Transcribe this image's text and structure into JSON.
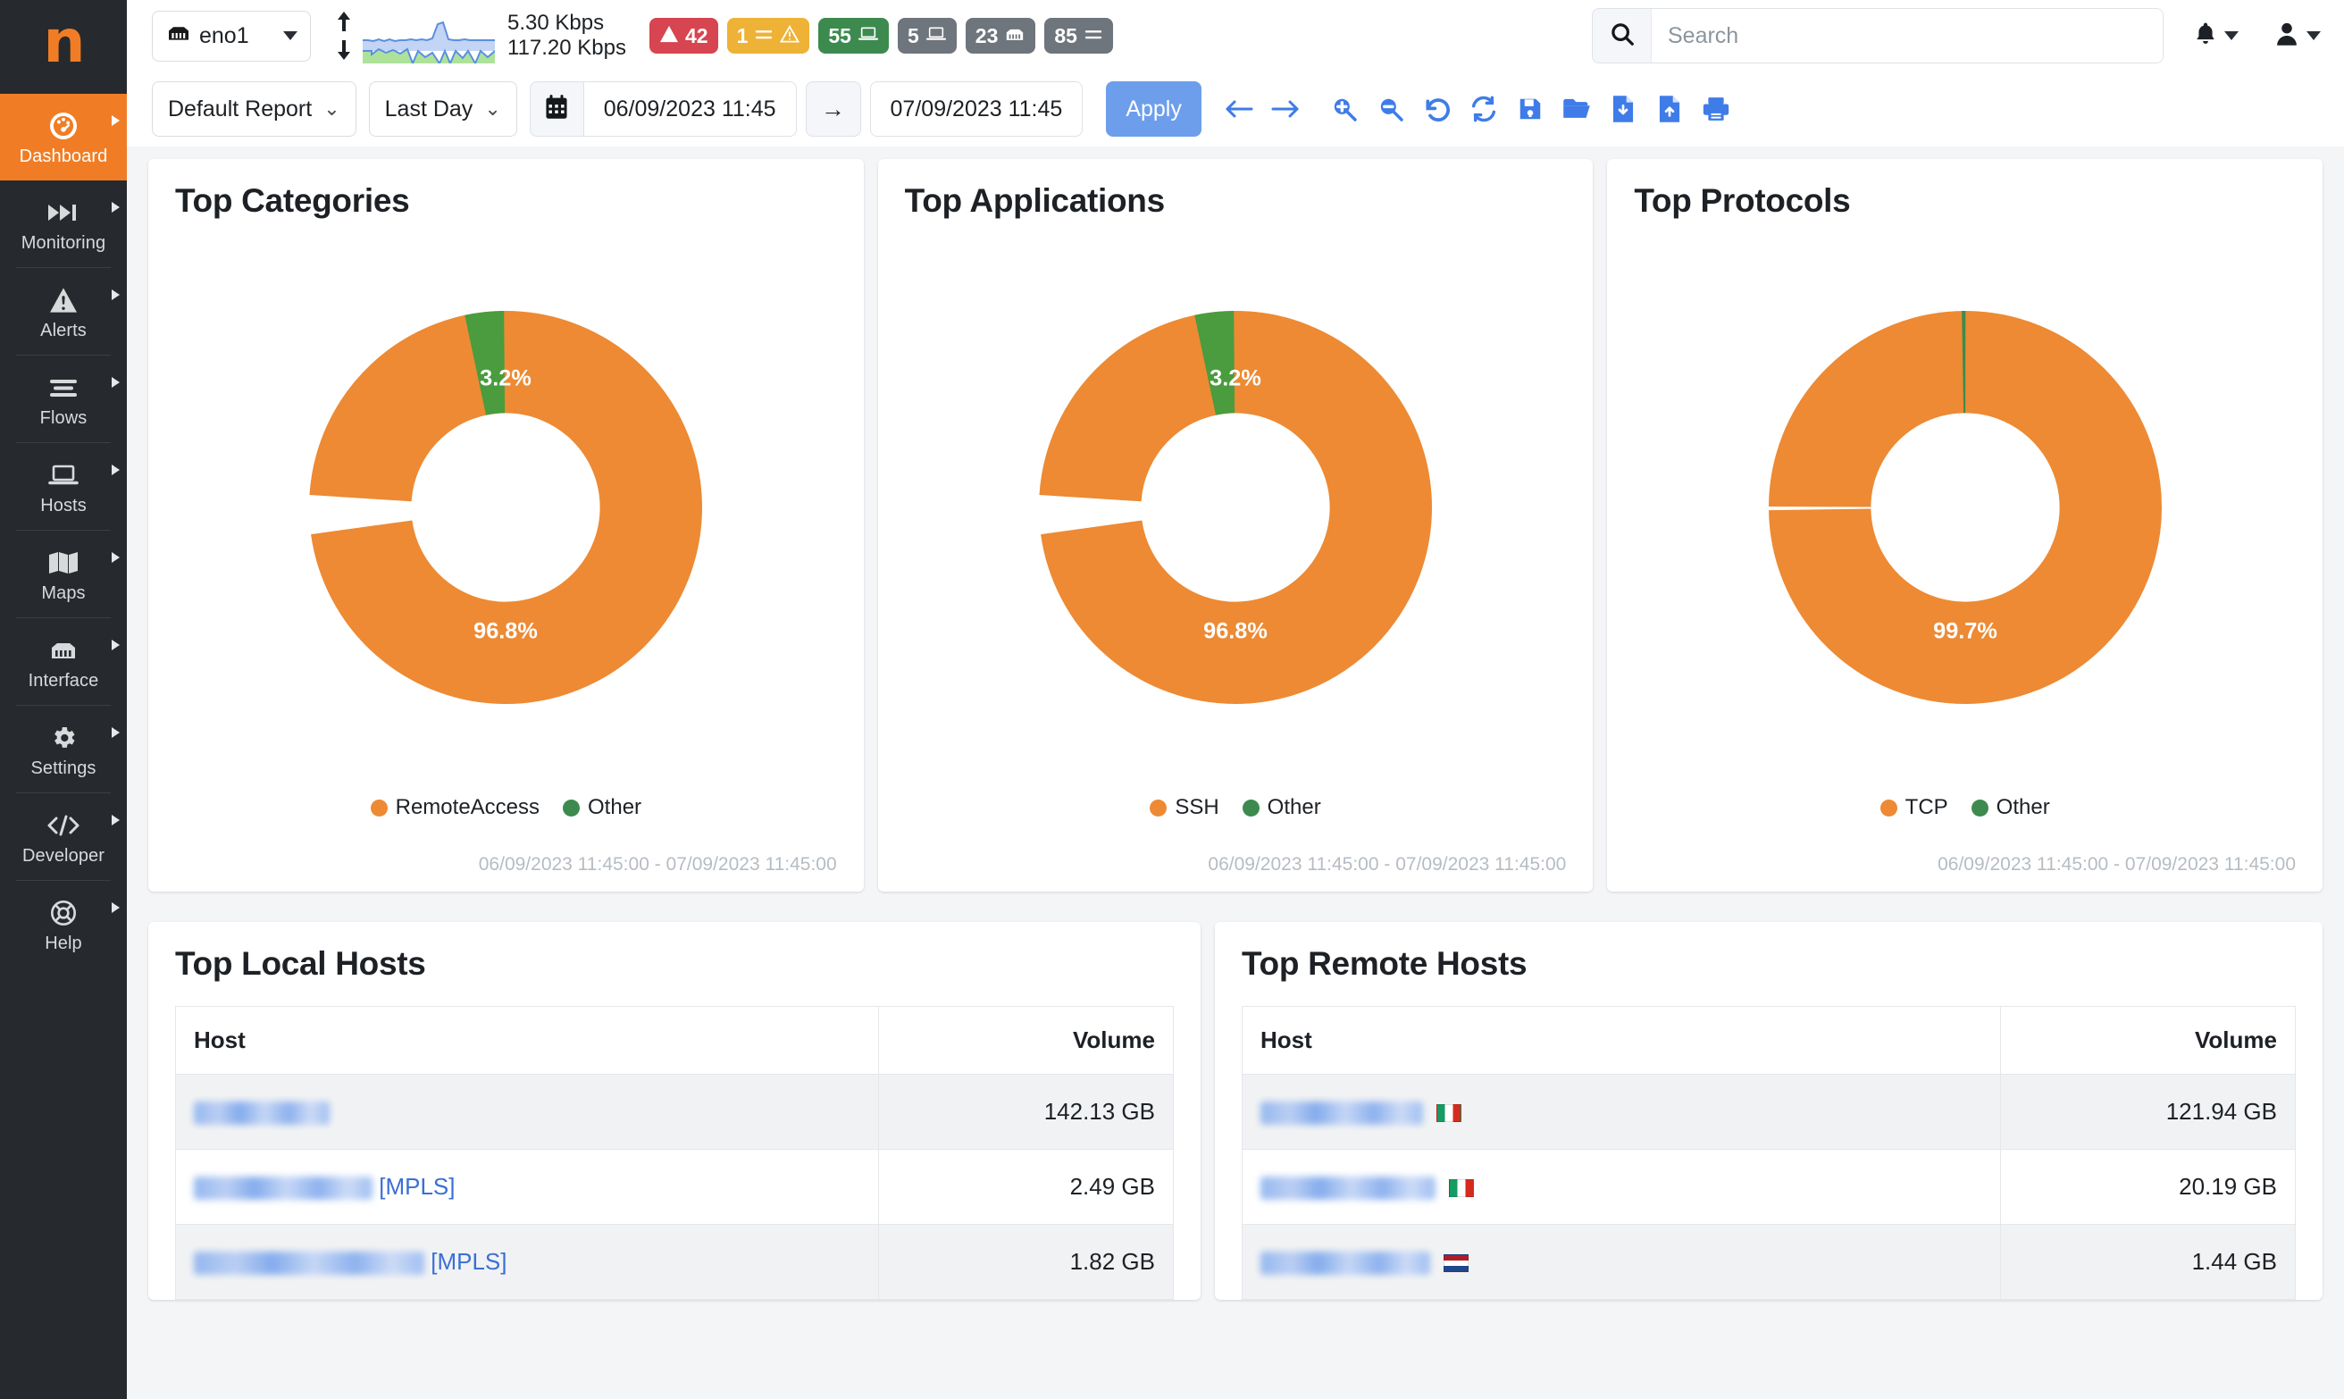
{
  "sidebar": {
    "logo": "n",
    "items": [
      {
        "label": "Dashboard",
        "icon": "dashboard-gauge-icon",
        "active": true
      },
      {
        "label": "Monitoring",
        "icon": "fast-forward-icon",
        "active": false
      },
      {
        "label": "Alerts",
        "icon": "warning-triangle-icon",
        "active": false
      },
      {
        "label": "Flows",
        "icon": "list-lines-icon",
        "active": false
      },
      {
        "label": "Hosts",
        "icon": "laptop-icon",
        "active": false
      },
      {
        "label": "Maps",
        "icon": "map-icon",
        "active": false
      },
      {
        "label": "Interface",
        "icon": "ethernet-port-icon",
        "active": false
      },
      {
        "label": "Settings",
        "icon": "gear-icon",
        "active": false
      },
      {
        "label": "Developer",
        "icon": "code-brackets-icon",
        "active": false
      },
      {
        "label": "Help",
        "icon": "lifebuoy-icon",
        "active": false
      }
    ]
  },
  "header": {
    "interface_selected": "eno1",
    "interface_icon": "ethernet-port-icon",
    "rate_up": "5.30 Kbps",
    "rate_down": "117.20 Kbps",
    "badges": [
      {
        "value": "42",
        "icon": "alert-triangle-icon",
        "color": "#d64550",
        "name": "alerts-badge"
      },
      {
        "value": "1",
        "icon": "flows-alert-icon",
        "color": "#eeb237",
        "name": "flow-alerts-badge"
      },
      {
        "value": "55",
        "icon": "device-icon",
        "color": "#3d8a4f",
        "name": "active-devices-badge"
      },
      {
        "value": "5",
        "icon": "device-icon",
        "color": "#6e757c",
        "name": "inactive-devices-badge"
      },
      {
        "value": "23",
        "icon": "ethernet-port-icon",
        "color": "#6e757c",
        "name": "interfaces-badge"
      },
      {
        "value": "85",
        "icon": "list-lines-icon",
        "color": "#6e757c",
        "name": "flows-badge"
      }
    ],
    "search_placeholder": "Search",
    "search_value": "",
    "notifications_icon": "bell-icon",
    "user_icon": "user-icon"
  },
  "toolbar": {
    "report_label": "Default Report",
    "range_label": "Last Day",
    "calendar_icon": "calendar-icon",
    "date_from": "06/09/2023 11:45",
    "date_to": "07/09/2023 11:45",
    "range_arrow": "→",
    "apply_label": "Apply",
    "icons": [
      {
        "name": "back-arrow-icon",
        "glyph": "←"
      },
      {
        "name": "forward-arrow-icon",
        "glyph": "→"
      },
      {
        "name": "zoom-in-icon",
        "glyph": ""
      },
      {
        "name": "zoom-out-icon",
        "glyph": ""
      },
      {
        "name": "undo-icon",
        "glyph": ""
      },
      {
        "name": "refresh-icon",
        "glyph": ""
      },
      {
        "name": "save-icon",
        "glyph": ""
      },
      {
        "name": "open-folder-icon",
        "glyph": ""
      },
      {
        "name": "file-download-icon",
        "glyph": ""
      },
      {
        "name": "file-upload-icon",
        "glyph": ""
      },
      {
        "name": "print-icon",
        "glyph": ""
      }
    ],
    "accent_color": "#3f7ce8"
  },
  "colors": {
    "orange": "#ed8a33",
    "green": "#4a9c3e",
    "sidebar": "#262a2e",
    "active": "#f07d25"
  },
  "chart_data": [
    {
      "type": "pie",
      "title": "Top Categories",
      "categories": [
        "RemoteAccess",
        "Other"
      ],
      "values": [
        96.8,
        3.2
      ],
      "labels": [
        "96.8%",
        "3.2%"
      ],
      "colors": [
        "#ed8a33",
        "#4a9c3e"
      ],
      "legend_position": "bottom",
      "donut": true,
      "timerange": "06/09/2023 11:45:00 - 07/09/2023 11:45:00"
    },
    {
      "type": "pie",
      "title": "Top Applications",
      "categories": [
        "SSH",
        "Other"
      ],
      "values": [
        96.8,
        3.2
      ],
      "labels": [
        "96.8%",
        "3.2%"
      ],
      "colors": [
        "#ed8a33",
        "#4a9c3e"
      ],
      "legend_position": "bottom",
      "donut": true,
      "timerange": "06/09/2023 11:45:00 - 07/09/2023 11:45:00"
    },
    {
      "type": "pie",
      "title": "Top Protocols",
      "categories": [
        "TCP",
        "Other"
      ],
      "values": [
        99.7,
        0.3
      ],
      "labels": [
        "99.7%",
        ""
      ],
      "colors": [
        "#ed8a33",
        "#4a9c3e"
      ],
      "legend_position": "bottom",
      "donut": true,
      "timerange": "06/09/2023 11:45:00 - 07/09/2023 11:45:00"
    }
  ],
  "tables": {
    "local": {
      "title": "Top Local Hosts",
      "columns": [
        "Host",
        "Volume"
      ],
      "rows": [
        {
          "host": "",
          "redacted_width": 152,
          "tag": "",
          "flag": "",
          "volume": "142.13 GB"
        },
        {
          "host": "",
          "redacted_width": 200,
          "tag": "[MPLS]",
          "flag": "",
          "volume": "2.49 GB"
        },
        {
          "host": "",
          "redacted_width": 258,
          "tag": "[MPLS]",
          "flag": "",
          "volume": "1.82 GB"
        }
      ]
    },
    "remote": {
      "title": "Top Remote Hosts",
      "columns": [
        "Host",
        "Volume"
      ],
      "rows": [
        {
          "host": "",
          "redacted_width": 182,
          "tag": "",
          "flag": "flag-it",
          "volume": "121.94 GB"
        },
        {
          "host": "",
          "redacted_width": 196,
          "tag": "",
          "flag": "flag-it",
          "volume": "20.19 GB"
        },
        {
          "host": "",
          "redacted_width": 190,
          "tag": "",
          "flag": "flag-nl",
          "volume": "1.44 GB"
        }
      ]
    }
  }
}
